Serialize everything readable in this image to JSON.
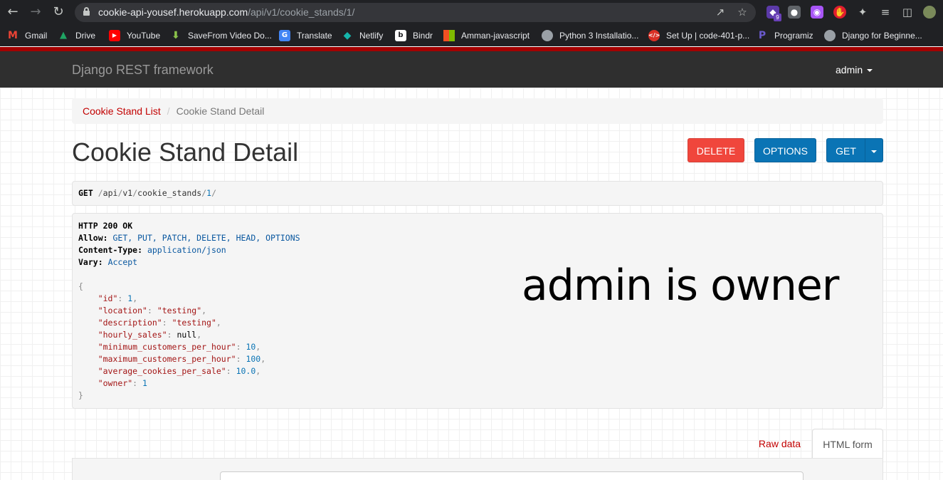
{
  "browser": {
    "url_host": "cookie-api-yousef.herokuapp.com",
    "url_path": "/api/v1/cookie_stands/1/",
    "extension_badge": "9"
  },
  "bookmarks": [
    {
      "label": "Gmail",
      "icon": "gmail-icon",
      "color": "#ea4335"
    },
    {
      "label": "Drive",
      "icon": "drive-icon",
      "color": "#1fa463"
    },
    {
      "label": "YouTube",
      "icon": "youtube-icon",
      "color": "#ff0000"
    },
    {
      "label": "SaveFrom Video Do...",
      "icon": "savefrom-icon",
      "color": "#8bc34a"
    },
    {
      "label": "Translate",
      "icon": "translate-icon",
      "color": "#4285f4"
    },
    {
      "label": "Netlify",
      "icon": "netlify-icon",
      "color": "#15b5ab"
    },
    {
      "label": "Bindr",
      "icon": "bindr-icon",
      "color": "#ffffff"
    },
    {
      "label": "Amman-javascript",
      "icon": "microsoft-icon",
      "color": "#f25022"
    },
    {
      "label": "Python 3 Installatio...",
      "icon": "globe-icon",
      "color": "#9aa0a6"
    },
    {
      "label": "Set Up | code-401-p...",
      "icon": "code-icon",
      "color": "#d93025"
    },
    {
      "label": "Programiz",
      "icon": "programiz-icon",
      "color": "#6a5acd"
    },
    {
      "label": "Django for Beginne...",
      "icon": "globe-icon",
      "color": "#9aa0a6"
    }
  ],
  "navbar": {
    "brand": "Django REST framework",
    "user": "admin"
  },
  "breadcrumb": {
    "link": "Cookie Stand List",
    "active": "Cookie Stand Detail"
  },
  "page": {
    "title": "Cookie Stand Detail"
  },
  "buttons": {
    "delete": "DELETE",
    "options": "OPTIONS",
    "get": "GET"
  },
  "request": {
    "method": "GET",
    "seg1": "api",
    "seg2": "v1",
    "seg3": "cookie_stands",
    "seg4": "1"
  },
  "response": {
    "status": "HTTP 200 OK",
    "headers": {
      "allow_name": "Allow:",
      "allow_value": "GET, PUT, PATCH, DELETE, HEAD, OPTIONS",
      "content_type_name": "Content-Type:",
      "content_type_value": "application/json",
      "vary_name": "Vary:",
      "vary_value": "Accept"
    },
    "json": {
      "id_key": "\"id\"",
      "id_val": "1",
      "location_key": "\"location\"",
      "location_val": "\"testing\"",
      "description_key": "\"description\"",
      "description_val": "\"testing\"",
      "hourly_sales_key": "\"hourly_sales\"",
      "hourly_sales_val": "null",
      "min_key": "\"minimum_customers_per_hour\"",
      "min_val": "10",
      "max_key": "\"maximum_customers_per_hour\"",
      "max_val": "100",
      "avg_key": "\"average_cookies_per_sale\"",
      "avg_val": "10.0",
      "owner_key": "\"owner\"",
      "owner_val": "1"
    }
  },
  "overlay": {
    "text": "admin is owner"
  },
  "tabs": {
    "raw": "Raw data",
    "html": "HTML form"
  }
}
